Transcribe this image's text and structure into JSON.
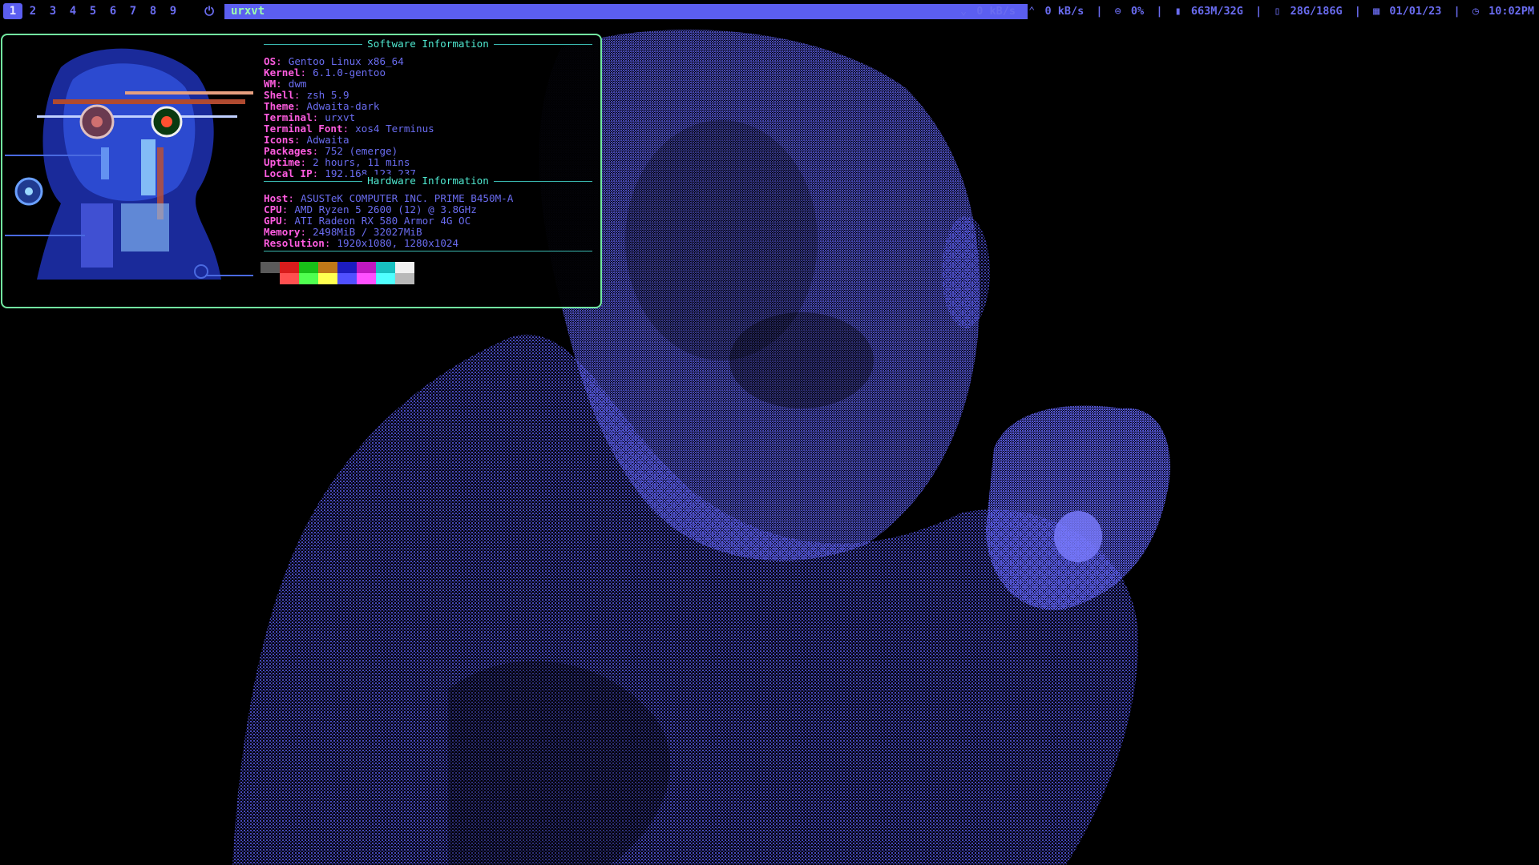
{
  "topbar": {
    "workspaces": [
      "1",
      "2",
      "3",
      "4",
      "5",
      "6",
      "7",
      "8",
      "9"
    ],
    "active_workspace": "1",
    "power_icon": "power-icon",
    "window_title": "urxvt",
    "net_down": "0 kB/s",
    "net_up": "0 kB/s",
    "cpu": "0%",
    "memory": "663M/32G",
    "disk": "28G/186G",
    "date": "01/01/23",
    "time": "10:02PM",
    "icons": {
      "down": "chevron-down-icon",
      "up": "chevron-up-icon",
      "cpu": "cpu-icon",
      "memory": "memory-icon",
      "disk": "disk-icon",
      "date": "calendar-icon",
      "time": "clock-icon"
    }
  },
  "fetch": {
    "software_header": "Software Information",
    "software": [
      {
        "key": "OS",
        "value": "Gentoo Linux x86_64"
      },
      {
        "key": "Kernel",
        "value": "6.1.0-gentoo"
      },
      {
        "key": "WM",
        "value": "dwm"
      },
      {
        "key": "Shell",
        "value": "zsh 5.9"
      },
      {
        "key": "Theme",
        "value": "Adwaita-dark"
      },
      {
        "key": "Terminal",
        "value": "urxvt"
      },
      {
        "key": "Terminal Font",
        "value": "xos4 Terminus"
      },
      {
        "key": "Icons",
        "value": "Adwaita"
      },
      {
        "key": "Packages",
        "value": "752 (emerge)"
      },
      {
        "key": "Uptime",
        "value": "2 hours, 11 mins"
      },
      {
        "key": "Local IP",
        "value": "192.168.123.237"
      }
    ],
    "hardware_header": "Hardware Information",
    "hardware": [
      {
        "key": "Host",
        "value": "ASUSTeK COMPUTER INC. PRIME B450M-A"
      },
      {
        "key": "CPU",
        "value": "AMD Ryzen 5 2600 (12) @ 3.8GHz"
      },
      {
        "key": "GPU",
        "value": "ATI Radeon RX 580 Armor 4G OC"
      },
      {
        "key": "Memory",
        "value": "2498MiB / 32027MiB"
      },
      {
        "key": "Resolution",
        "value": "1920x1080, 1280x1024"
      }
    ],
    "palette_top": [
      "#5a5a5a",
      "#d81c1c",
      "#18c018",
      "#c07818",
      "#1c1cc0",
      "#c018c0",
      "#18c0c0",
      "#f0f0f0"
    ],
    "palette_bottom": [
      "#000000",
      "#ff5050",
      "#50ff50",
      "#ffff50",
      "#5050ff",
      "#ff50ff",
      "#50ffff",
      "#b8b8b8"
    ]
  },
  "colors": {
    "accent": "#5b5ef0",
    "bar_text": "#6a6cf0",
    "title_text": "#9cffb0",
    "border": "#72e8a0",
    "key": "#ff5ce0",
    "value": "#6a6cf0",
    "header": "#4fe8d0"
  }
}
